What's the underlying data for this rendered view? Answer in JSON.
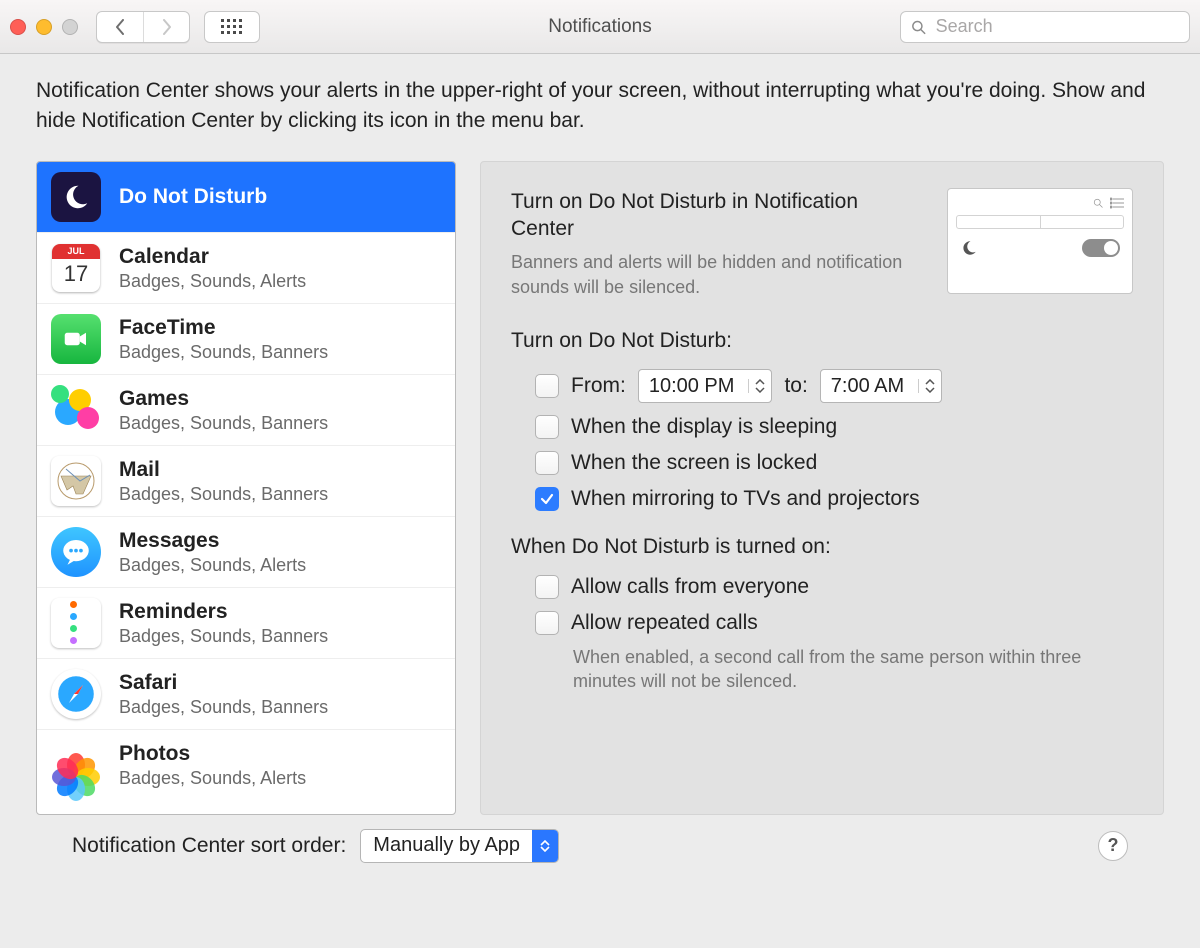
{
  "window": {
    "title": "Notifications"
  },
  "search": {
    "placeholder": "Search"
  },
  "description": "Notification Center shows your alerts in the upper-right of your screen, without interrupting what you're doing. Show and hide Notification Center by clicking its icon in the menu bar.",
  "sidebar": {
    "items": [
      {
        "label": "Do Not Disturb",
        "sub": "",
        "selected": true,
        "icon": "moon"
      },
      {
        "label": "Calendar",
        "sub": "Badges, Sounds, Alerts"
      },
      {
        "label": "FaceTime",
        "sub": "Badges, Sounds, Banners"
      },
      {
        "label": "Games",
        "sub": "Badges, Sounds, Banners"
      },
      {
        "label": "Mail",
        "sub": "Badges, Sounds, Banners"
      },
      {
        "label": "Messages",
        "sub": "Badges, Sounds, Alerts"
      },
      {
        "label": "Reminders",
        "sub": "Badges, Sounds, Banners"
      },
      {
        "label": "Safari",
        "sub": "Badges, Sounds, Banners"
      },
      {
        "label": "Photos",
        "sub": "Badges, Sounds, Alerts"
      }
    ]
  },
  "calendar_tile": {
    "month": "JUL",
    "day": "17"
  },
  "detail": {
    "title": "Turn on Do Not Disturb in Notification Center",
    "sub": "Banners and alerts will be hidden and notification sounds will be silenced.",
    "section1_label": "Turn on Do Not Disturb:",
    "from_label": "From:",
    "from_time": "10:00 PM",
    "to_label": "to:",
    "to_time": "7:00 AM",
    "opt_sleeping": "When the display is sleeping",
    "opt_locked": "When the screen is locked",
    "opt_mirroring": "When mirroring to TVs and projectors",
    "section2_label": "When Do Not Disturb is turned on:",
    "opt_allow_everyone": "Allow calls from everyone",
    "opt_allow_repeated": "Allow repeated calls",
    "opt_repeated_hint": "When enabled, a second call from the same person within three minutes will not be silenced.",
    "checks": {
      "from": false,
      "sleeping": false,
      "locked": false,
      "mirroring": true,
      "everyone": false,
      "repeated": false
    }
  },
  "bottom": {
    "sort_label": "Notification Center sort order:",
    "sort_value": "Manually by App"
  },
  "help": "?"
}
